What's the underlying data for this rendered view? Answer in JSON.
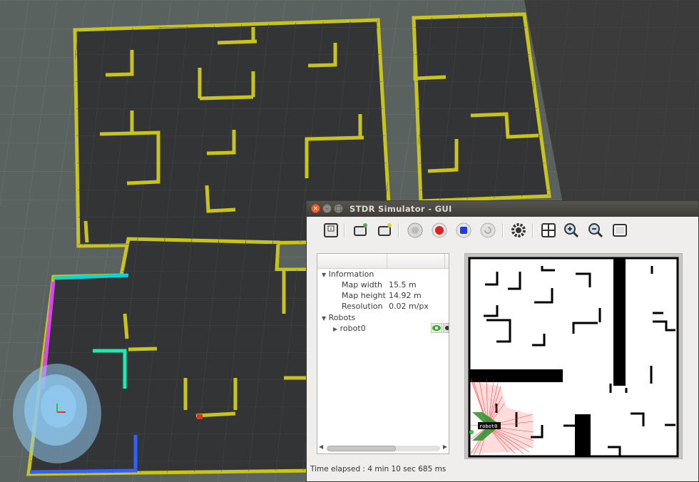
{
  "window": {
    "title": "STDR Simulator - GUI",
    "close_glyph": "×",
    "minimize_glyph": "–",
    "maximize_glyph": "□"
  },
  "toolbar": {
    "icons": [
      "save-map-icon",
      "add-robot-icon",
      "add-rfid-icon",
      "robot-config-icon",
      "record-icon",
      "stop-icon",
      "replay-icon",
      "settings-icon",
      "grid-icon",
      "zoom-in-icon",
      "zoom-out-icon",
      "adjust-view-icon"
    ]
  },
  "tree": {
    "information_label": "Information",
    "items": [
      {
        "key": "Map width",
        "value": "15.5 m"
      },
      {
        "key": "Map height",
        "value": "14.92 m"
      },
      {
        "key": "Resolution",
        "value": "0.02 m/px"
      }
    ],
    "robots_label": "Robots",
    "robot_name": "robot0"
  },
  "map": {
    "robot_label": "robot0"
  },
  "status": {
    "text": "Time elapsed : 4 min 10 sec 685 ms"
  },
  "colors": {
    "wall": "#c8c41c",
    "floor": "#333436",
    "ground": "#5a625f",
    "laser": "#ff3030",
    "particles": "#8fc8ef"
  }
}
